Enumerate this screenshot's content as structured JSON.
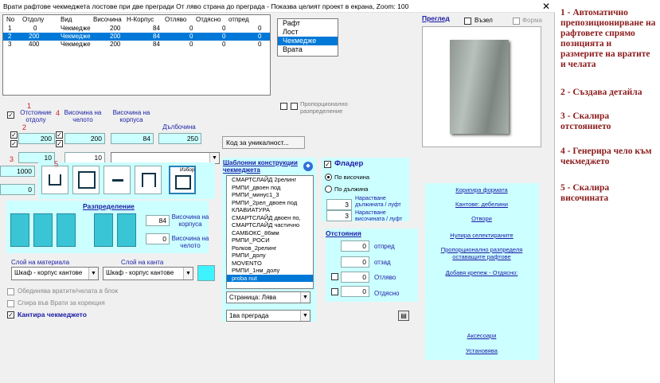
{
  "title": "Врати рафтове чекмеджета лостове при две прегради  От ляво страна до преграда - Показва целият проект в екрана, Zoom:  100",
  "table": {
    "headers": [
      "No",
      "Отдолу",
      "Вид",
      "Височина",
      "Н-Корпус",
      "Отляво",
      "Отдясно",
      "отпред"
    ],
    "rows": [
      [
        "1",
        "0",
        "Чекмедже",
        "200",
        "84",
        "0",
        "0",
        "0"
      ],
      [
        "2",
        "200",
        "Чекмедже",
        "200",
        "84",
        "0",
        "0",
        "0"
      ],
      [
        "3",
        "400",
        "Чекмедже",
        "200",
        "84",
        "0",
        "0",
        "0"
      ]
    ],
    "selected_row": 1
  },
  "type_list": {
    "items": [
      "Рафт",
      "Лост",
      "Чекмедже",
      "Врата"
    ],
    "selected": "Чекмедже"
  },
  "proportional_label": "Пропорционално разпределение",
  "preview": {
    "title": "Преглед",
    "viseal": "Възел",
    "form": "Форма"
  },
  "dims": {
    "label_distance": "Отстояние отдолу",
    "label_front_height": "Височина на челото",
    "label_body_height": "Височина на корпуса",
    "label_depth": "Дълбочина",
    "distance_value": "200",
    "front_height_value": "200",
    "body_height_value": "84",
    "depth_value": "250",
    "small_value": "10",
    "hl_value": "10",
    "unique_code_button": "Код за уникалност...",
    "left_value1": "1000",
    "left_value2": "0",
    "choice_label": "Избор"
  },
  "distribution": {
    "title": "Разпределение",
    "body_height_label": "Височина на корпуса",
    "body_height_value": "84",
    "front_height_label": "Височина на челото",
    "front_height_value": "0"
  },
  "templates": {
    "title": "Шаблонни конструкции чекмеджета",
    "items": [
      "СМАРТСЛАЙД 2релинг",
      "РМПИ_двоен под",
      "РМПИ_минус1_3",
      "РМПИ_2рел_двоен под",
      "КЛАВИАТУРА",
      "СМАРТСЛАЙД двоен по,",
      "СМАРТСЛАЙД частично",
      "САМБОКС_86мм",
      "РМПИ_РОСИ",
      "Ролков_2релинг",
      "РМПИ_долу",
      "MOVENTO",
      "РМПИ_1нм_долу",
      "proba nut"
    ],
    "selected": "proba nut",
    "page_select": "Страница: Лява",
    "partition_select": "1ва преграда"
  },
  "fladder": {
    "title": "Фладер",
    "checked": true,
    "option_height": "По височина",
    "option_length": "По дължина",
    "selected": "По височина",
    "grow_length_label": "Нарастване дължината / луфт",
    "grow_length_value": "3",
    "grow_height_label": "Нарастване височината / луфт",
    "grow_height_value": "3"
  },
  "offsets": {
    "title": "Отстояния",
    "front_label": "отпред",
    "front_value": "0",
    "back_label": "отзад",
    "back_value": "0",
    "left_label": "Отляво",
    "left_value": "0",
    "right_label": "Отдясно",
    "right_value": "0"
  },
  "right_links": {
    "fix_form": "Коригира формата",
    "edges": "Кантове: дебелини",
    "open": "Отвори",
    "reset": "Нулира селектираните",
    "proportional": "Пропорционално разпределя оставащите рафтове",
    "add_fastener": "Добавя крепеж  -  Отдясно:",
    "accessories": "Аксесоари",
    "settings": "Установява"
  },
  "materials": {
    "layer_material_label": "Слой на материала",
    "layer_edge_label": "Слой на канта",
    "material_select": "Шкаф - корпус кантове",
    "edge_select": "Шкаф - корпус кантове",
    "unify_label": "Обединява вратите/челата в блок",
    "stop_label": "Спира във Врати за корекция",
    "edge_drawer_label": "Кантира чекмеджето"
  },
  "annotations": [
    "1 - Автоматично препозиционирване на рафтовете спрямо позицията и размерите на вратите и челата",
    "2 - Създава детайла",
    "3 - Скалира отстоянието",
    "4 - Генерира чело към чекмеджето",
    "5 - Скалира височината"
  ],
  "markers": [
    "1",
    "2",
    "3",
    "4",
    "5"
  ]
}
